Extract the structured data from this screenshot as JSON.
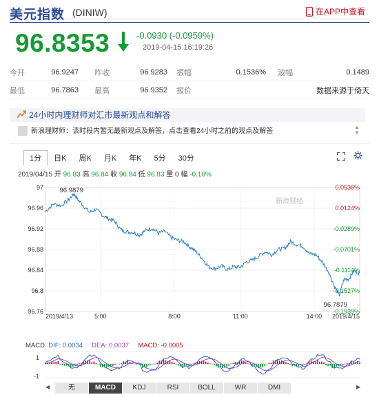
{
  "header": {
    "title": "美元指数",
    "symbol": "(DINIW)",
    "app_link": "在APP中查看",
    "price": "96.8353",
    "change": "-0.0930 (-0.0959%)",
    "timestamp": "2019-04-15 16:19:26"
  },
  "colors": {
    "down": "#149b34",
    "up": "#c8161e",
    "brand": "#2a4a99",
    "line": "#2d7fc3"
  },
  "stats": [
    [
      {
        "label": "今开",
        "value": "96.9247"
      },
      {
        "label": "昨收",
        "value": "96.9283"
      },
      {
        "label": "振幅",
        "value": "0.1536%"
      },
      {
        "label": "波幅",
        "value": "0.1489"
      }
    ],
    [
      {
        "label": "最低",
        "value": "96.7863"
      },
      {
        "label": "最高",
        "value": "96.9352"
      },
      {
        "label": "报价",
        "value": ""
      },
      {
        "label": "",
        "value": "数据来源于倚天"
      }
    ]
  ],
  "notice": {
    "title": "24小时内理财师对汇市最新观点和解答",
    "text": "新浪理财师：该时段内暂无最新观点及解答，点击查看24小时之前的观点及解答"
  },
  "tabs": [
    "1分",
    "日K",
    "周K",
    "月K",
    "年K",
    "5分",
    "30分"
  ],
  "quote_line": {
    "date": "2019/04/15",
    "open_label": "开",
    "open": "96.83",
    "high_label": "高",
    "high": "96.84",
    "close_label": "收",
    "close": "96.84",
    "low_label": "低",
    "low": "96.83",
    "vol_label": "量",
    "vol": "0",
    "chg_label": "幅",
    "chg": "-0.10%"
  },
  "watermark": "新浪财经",
  "chart_data": {
    "type": "line",
    "prev_close": 96.9283,
    "ylim": [
      96.76,
      97.0
    ],
    "y_ticks": [
      "97",
      "96.96",
      "96.92",
      "96.88",
      "96.84",
      "96.8",
      "96.76"
    ],
    "pct_ticks": [
      "0.0536%",
      "0.0124%",
      "-0.0289%",
      "-0.0701%",
      "-0.1114%",
      "-0.1527%",
      "-0.1939%"
    ],
    "x_ticks": [
      "2019/4/13",
      "5:00",
      "8:00",
      "11:00",
      "14:00",
      "2019/4/15"
    ],
    "high_label": "96.9879",
    "low_label": "96.7879",
    "x": [
      0,
      0.025,
      0.05,
      0.075,
      0.09,
      0.1,
      0.12,
      0.14,
      0.16,
      0.18,
      0.2,
      0.22,
      0.24,
      0.26,
      0.28,
      0.3,
      0.32,
      0.34,
      0.36,
      0.38,
      0.4,
      0.42,
      0.44,
      0.46,
      0.48,
      0.5,
      0.52,
      0.54,
      0.56,
      0.58,
      0.6,
      0.62,
      0.64,
      0.66,
      0.68,
      0.7,
      0.72,
      0.74,
      0.76,
      0.78,
      0.8,
      0.82,
      0.84,
      0.86,
      0.88,
      0.9,
      0.92,
      0.935,
      0.95,
      0.965,
      0.98,
      1.0
    ],
    "values": [
      96.954,
      96.968,
      96.965,
      96.977,
      96.988,
      96.979,
      96.965,
      96.952,
      96.958,
      96.947,
      96.94,
      96.935,
      96.918,
      96.914,
      96.913,
      96.908,
      96.918,
      96.921,
      96.912,
      96.915,
      96.903,
      96.898,
      96.895,
      96.885,
      96.875,
      96.862,
      96.846,
      96.843,
      96.848,
      96.841,
      96.847,
      96.846,
      96.856,
      96.86,
      96.868,
      96.876,
      96.87,
      96.88,
      96.882,
      96.895,
      96.89,
      96.886,
      96.872,
      96.87,
      96.857,
      96.838,
      96.808,
      96.792,
      96.822,
      96.823,
      96.838,
      96.834
    ]
  },
  "macd": {
    "name": "MACD",
    "dif_label": "DIF:",
    "dif": "0.0034",
    "dea_label": "DEA:",
    "dea": "0.0037",
    "macd_label": "MACD:",
    "macd": "-0.0005",
    "ticks": [
      "1",
      "-1"
    ]
  },
  "bottom_tabs": [
    "无",
    "MACD",
    "KDJ",
    "RSI",
    "BOLL",
    "WR",
    "DMI"
  ],
  "bottom_active": 1
}
